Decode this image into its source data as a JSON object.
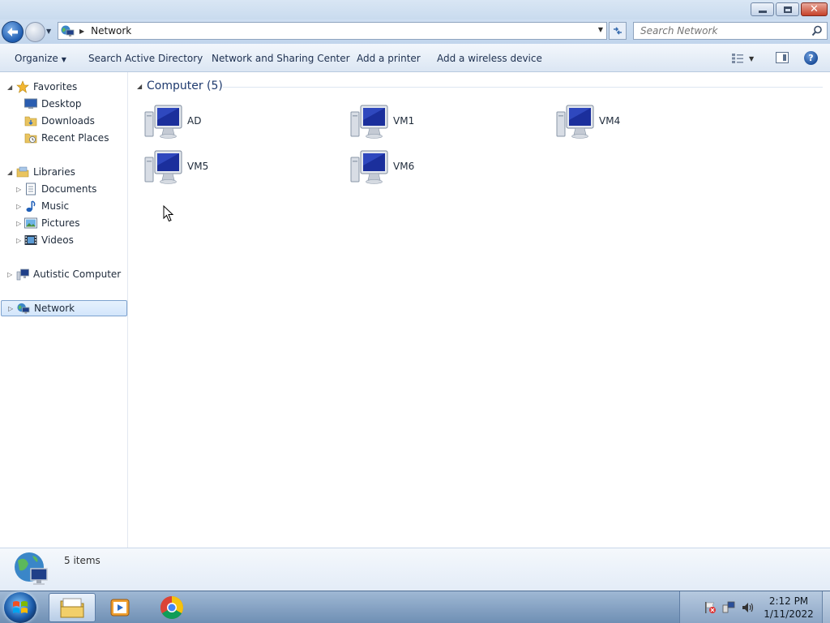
{
  "window": {
    "caption_buttons": [
      "minimize-icon",
      "restore-icon",
      "close-icon"
    ]
  },
  "navbar": {
    "address_segment": "Network",
    "search_placeholder": "Search Network",
    "icons": [
      "back-arrow-icon",
      "forward-arrow-icon",
      "network-icon",
      "refresh-icon",
      "search-icon"
    ]
  },
  "commandbar": {
    "organize": "Organize",
    "search_ad": "Search Active Directory",
    "network_sharing": "Network and Sharing Center",
    "add_printer": "Add a printer",
    "add_wireless": "Add a wireless device"
  },
  "navpane": {
    "favorites": "Favorites",
    "desktop": "Desktop",
    "downloads": "Downloads",
    "recent_places": "Recent Places",
    "libraries": "Libraries",
    "documents": "Documents",
    "music": "Music",
    "pictures": "Pictures",
    "videos": "Videos",
    "computer": "Autistic Computer",
    "network": "Network"
  },
  "content": {
    "group_title": "Computer (5)",
    "items": [
      {
        "name": "AD"
      },
      {
        "name": "VM1"
      },
      {
        "name": "VM4"
      },
      {
        "name": "VM5"
      },
      {
        "name": "VM6"
      }
    ]
  },
  "details": {
    "count": "5 items"
  },
  "taskbar": {
    "time": "2:12 PM",
    "date": "1/11/2022",
    "pinned": [
      "windows-explorer-icon",
      "media-player-icon",
      "chrome-icon"
    ],
    "tray": [
      "action-center-flag-icon",
      "network-tray-icon",
      "volume-icon"
    ]
  },
  "colors": {
    "accent": "#1e5cb0",
    "group_title": "#1e3a6e",
    "selection": "#d3e6fb"
  }
}
